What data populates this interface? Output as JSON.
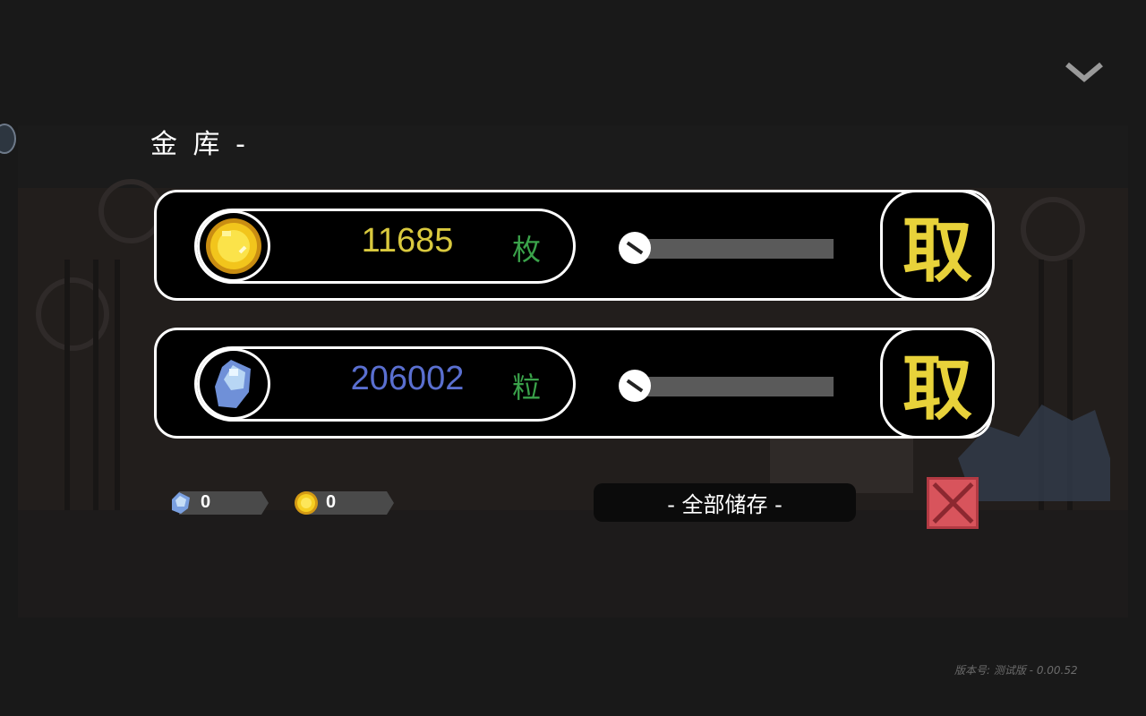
{
  "vault": {
    "title": "金 库 -"
  },
  "resources": [
    {
      "kind": "gold",
      "amount": "11685",
      "unit": "枚",
      "amount_color": "#d9c93e",
      "take_label": "取",
      "slider_fraction": 0.0
    },
    {
      "kind": "gem",
      "amount": "206002",
      "unit": "粒",
      "amount_color": "#5a6fd0",
      "take_label": "取",
      "slider_fraction": 0.0
    }
  ],
  "wallet": {
    "gem_count": "0",
    "gold_count": "0"
  },
  "actions": {
    "store_all_label": "- 全部储存 -"
  },
  "footer": {
    "version": "版本号: 测试版 - 0.00.52"
  },
  "icons": {
    "collapse": "chevron-down-icon",
    "close": "close-icon",
    "gold": "gold-coin-icon",
    "gem": "gem-icon"
  },
  "colors": {
    "unit": "#3aa24a",
    "take": "#e8d23a",
    "close": "#d8545c"
  }
}
